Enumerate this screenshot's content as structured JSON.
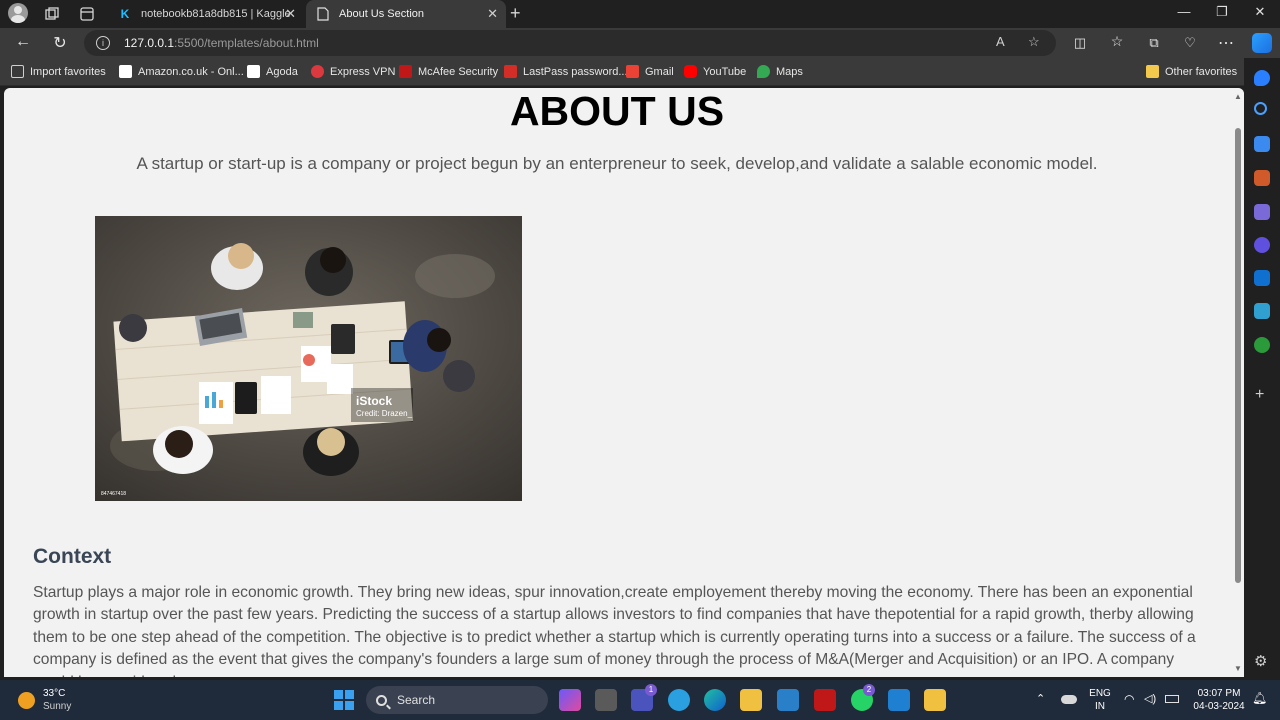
{
  "browser": {
    "tabs": [
      {
        "title": "notebookb81a8db815 | Kaggle",
        "favicon": "K"
      },
      {
        "title": "About Us Section"
      }
    ],
    "url_host": "127.0.0.1",
    "url_rest": ":5500/templates/about.html",
    "favorites": [
      {
        "label": "Import favorites",
        "icon": "import-icon",
        "color": "#cfcfcf"
      },
      {
        "label": "Amazon.co.uk - Onl...",
        "icon": "amazon-icon",
        "color": "#ffffff"
      },
      {
        "label": "Agoda",
        "icon": "agoda-icon",
        "color": "#ffffff"
      },
      {
        "label": "Express VPN",
        "icon": "expressvpn-icon",
        "color": "#da3940"
      },
      {
        "label": "McAfee Security",
        "icon": "mcafee-icon",
        "color": "#c01818"
      },
      {
        "label": "LastPass password...",
        "icon": "lastpass-icon",
        "color": "#d32d27"
      },
      {
        "label": "Gmail",
        "icon": "gmail-icon",
        "color": "#ea4335"
      },
      {
        "label": "YouTube",
        "icon": "youtube-icon",
        "color": "#ff0000"
      },
      {
        "label": "Maps",
        "icon": "maps-icon",
        "color": "#34a853"
      }
    ],
    "other_favorites": "Other favorites"
  },
  "page": {
    "title": "ABOUT US",
    "lead": "A startup or start-up is a company or project begun by an enterpreneur to seek, develop,and validate a salable economic model.",
    "image": {
      "watermark": "iStock",
      "credit": "Credit: Drazen_",
      "id": "847467418"
    },
    "context_heading": "Context",
    "context_text": "Startup plays a major role in economic growth. They bring new ideas, spur innovation,create employement thereby moving the economy. There has been an exponential growth in startup over the past few years. Predicting the success of a startup allows investors to find companies that have thepotential for a rapid growth, therby allowing them to be one step ahead of the competition. The objective is to predict whether a startup which is currently operating turns into a success or a failure. The success of a company is defined as the event that gives the company's founders a large sum of money through the process of M&A(Merger and Acquisition) or an IPO. A company would be considered"
  },
  "taskbar": {
    "weather_temp": "33°C",
    "weather_desc": "Sunny",
    "search_label": "Search",
    "badge_teams": "1",
    "badge_whatsapp": "2",
    "lang_1": "ENG",
    "lang_2": "IN",
    "time": "03:07 PM",
    "date": "04-03-2024"
  }
}
